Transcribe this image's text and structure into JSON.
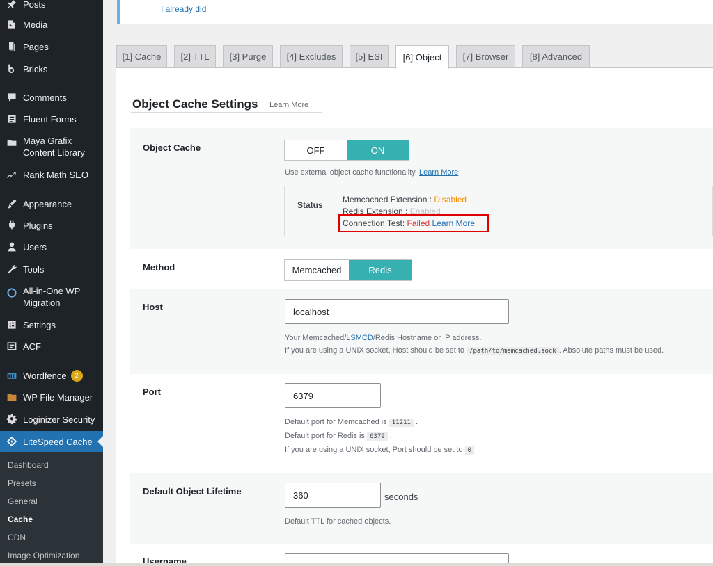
{
  "sidebar": {
    "items": [
      {
        "label": "Posts",
        "icon": "pin-icon"
      },
      {
        "label": "Media",
        "icon": "media-icon"
      },
      {
        "label": "Pages",
        "icon": "pages-icon"
      },
      {
        "label": "Bricks",
        "icon": "bricks-icon"
      },
      {
        "label": "Comments",
        "icon": "comments-icon"
      },
      {
        "label": "Fluent Forms",
        "icon": "forms-icon"
      },
      {
        "label": "Maya Grafix Content Library",
        "icon": "folder-icon"
      },
      {
        "label": "Rank Math SEO",
        "icon": "chart-icon"
      },
      {
        "label": "Appearance",
        "icon": "brush-icon"
      },
      {
        "label": "Plugins",
        "icon": "plugin-icon"
      },
      {
        "label": "Users",
        "icon": "user-icon"
      },
      {
        "label": "Tools",
        "icon": "wrench-icon"
      },
      {
        "label": "All-in-One WP Migration",
        "icon": "migration-icon"
      },
      {
        "label": "Settings",
        "icon": "settings-icon"
      },
      {
        "label": "ACF",
        "icon": "acf-icon"
      },
      {
        "label": "Wordfence",
        "icon": "wordfence-icon",
        "badge": "2"
      },
      {
        "label": "WP File Manager",
        "icon": "file-manager-icon"
      },
      {
        "label": "Loginizer Security",
        "icon": "gear-icon"
      },
      {
        "label": "LiteSpeed Cache",
        "icon": "litespeed-icon"
      }
    ],
    "submenu": [
      "Dashboard",
      "Presets",
      "General",
      "Cache",
      "CDN",
      "Image Optimization"
    ]
  },
  "notice": {
    "link": "I already did"
  },
  "tabs": [
    "[1] Cache",
    "[2] TTL",
    "[3] Purge",
    "[4] Excludes",
    "[5] ESI",
    "[6] Object",
    "[7] Browser",
    "[8] Advanced"
  ],
  "section": {
    "title": "Object Cache Settings",
    "learn_more": "Learn More"
  },
  "object_cache": {
    "label": "Object Cache",
    "off": "OFF",
    "on": "ON",
    "desc": "Use external object cache functionality.",
    "desc_link": "Learn More",
    "status": {
      "label": "Status",
      "memcached_label": "Memcached Extension :",
      "memcached_value": "Disabled",
      "redis_label": "Redis Extension :",
      "redis_value": "Enabled",
      "conn_label": "Connection Test:",
      "conn_value": "Failed",
      "conn_link": "Learn More"
    }
  },
  "method": {
    "label": "Method",
    "opt1": "Memcached",
    "opt2": "Redis"
  },
  "host": {
    "label": "Host",
    "value": "localhost",
    "desc1_a": "Your Memcached/",
    "desc1_link": "LSMCD",
    "desc1_b": "/Redis Hostname or IP address.",
    "desc2_a": "If you are using a UNIX socket, Host should be set to",
    "desc2_code": "/path/to/memcached.sock",
    "desc2_b": ". Absolute paths must be used."
  },
  "port": {
    "label": "Port",
    "value": "6379",
    "desc1_a": "Default port for Memcached is",
    "desc1_code": "11211",
    "desc2_a": "Default port for Redis is",
    "desc2_code": "6379",
    "desc3_a": "If you are using a UNIX socket, Port should be set to",
    "desc3_code": "0",
    "dot": "."
  },
  "lifetime": {
    "label": "Default Object Lifetime",
    "value": "360",
    "unit": "seconds",
    "desc": "Default TTL for cached objects."
  },
  "username": {
    "label": "Username"
  }
}
